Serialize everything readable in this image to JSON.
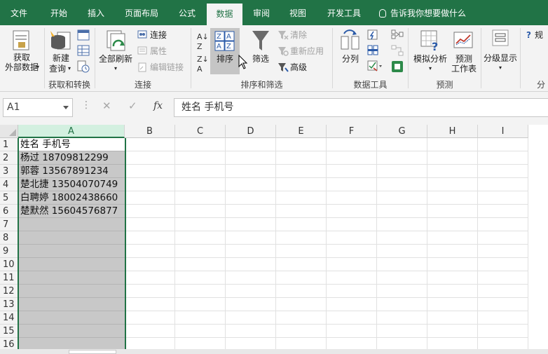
{
  "tabs": [
    {
      "label": "文件",
      "active": false
    },
    {
      "label": "开始",
      "active": false
    },
    {
      "label": "插入",
      "active": false
    },
    {
      "label": "页面布局",
      "active": false
    },
    {
      "label": "公式",
      "active": false
    },
    {
      "label": "数据",
      "active": true
    },
    {
      "label": "审阅",
      "active": false
    },
    {
      "label": "视图",
      "active": false
    },
    {
      "label": "开发工具",
      "active": false
    }
  ],
  "tell_me": "告诉我你想要做什么",
  "ribbon": {
    "get_external_line1": "获取",
    "get_external_line2": "外部数据",
    "new_query_line1": "新建",
    "new_query_line2": "查询",
    "refresh_all": "全部刷新",
    "connections": "连接",
    "properties": "属性",
    "edit_links": "编辑链接",
    "sort": "排序",
    "filter": "筛选",
    "clear": "清除",
    "reapply": "重新应用",
    "advanced": "高级",
    "text_to_columns": "分列",
    "what_if": "模拟分析",
    "forecast_line1": "预测",
    "forecast_line2": "工作表",
    "outline": "分级显示",
    "partial_right": "规",
    "groups": {
      "get_transform": "获取和转换",
      "connections": "连接",
      "sort_filter": "排序和筛选",
      "data_tools": "数据工具",
      "forecast": "预测",
      "partial": "分"
    }
  },
  "formula_bar": {
    "name_box": "A1",
    "cancel": "✕",
    "enter": "✓",
    "fx": "fx",
    "content": "姓名 手机号"
  },
  "sheet": {
    "columns": [
      "A",
      "B",
      "C",
      "D",
      "E",
      "F",
      "G",
      "H",
      "I"
    ],
    "rows": [
      "1",
      "2",
      "3",
      "4",
      "5",
      "6",
      "7",
      "8",
      "9",
      "10",
      "11",
      "12",
      "13",
      "14",
      "15",
      "16"
    ],
    "a_cells": [
      "姓名 手机号",
      "杨过 18709812299",
      "郭蓉 13567891234",
      "楚北捷 13504070749",
      "白聘婷 18002438660",
      "楚默然 15604576877",
      "",
      "",
      "",
      "",
      "",
      "",
      "",
      "",
      "",
      ""
    ]
  },
  "colors": {
    "accent": "#217346",
    "ribbon_bg": "#f3f3f3",
    "selection_fill": "#c8c8c8"
  }
}
